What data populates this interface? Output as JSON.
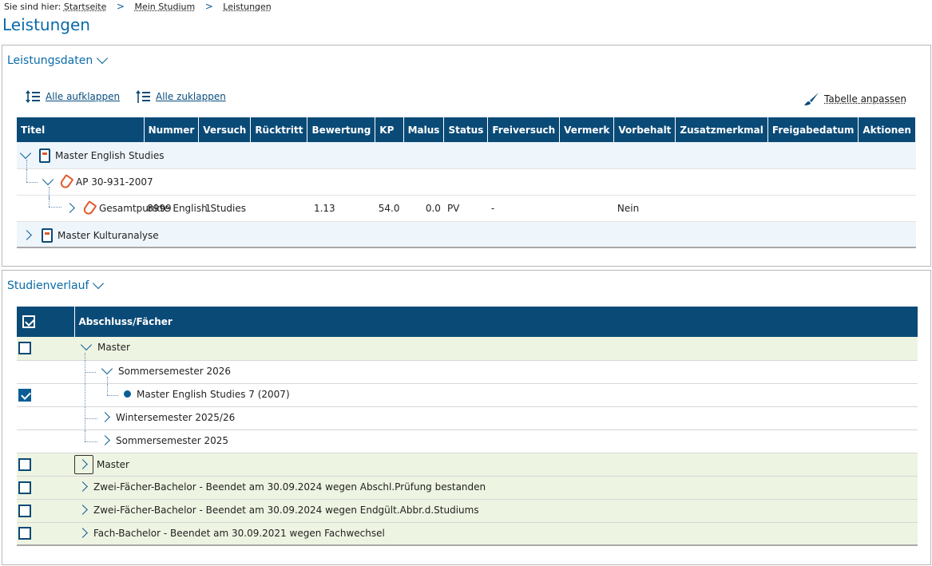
{
  "breadcrumb": {
    "prefix": "Sie sind hier:",
    "items": [
      "Startseite",
      "Mein Studium",
      "Leistungen"
    ]
  },
  "page_title": "Leistungen",
  "leistungsdaten": {
    "title": "Leistungsdaten",
    "expand_all": "Alle aufklappen",
    "collapse_all": "Alle zuklappen",
    "customize_table": "Tabelle anpassen",
    "columns": [
      "Titel",
      "Nummer",
      "Versuch",
      "Rücktritt",
      "Bewertung",
      "KP",
      "Malus",
      "Status",
      "Freiversuch",
      "Vermerk",
      "Vorbehalt",
      "Zusatzmerkmal",
      "Freigabedatum",
      "Aktionen"
    ],
    "rows": [
      {
        "title": "Master English Studies",
        "nummer": "",
        "versuch": "",
        "ruecktritt": "",
        "bewertung": "",
        "kp": "",
        "malus": "",
        "status": "",
        "freiversuch": "",
        "vermerk": "",
        "vorbehalt": ""
      },
      {
        "title": "AP 30-931-2007",
        "nummer": "",
        "versuch": "",
        "ruecktritt": "",
        "bewertung": "",
        "kp": "",
        "malus": "",
        "status": "",
        "freiversuch": "",
        "vermerk": "",
        "vorbehalt": ""
      },
      {
        "title": "Gesamtpunkte English Studies",
        "nummer": "8999",
        "versuch": "1",
        "ruecktritt": "",
        "bewertung": "1.13",
        "kp": "54.0",
        "malus": "0.0",
        "status": "PV",
        "freiversuch": "-",
        "vermerk": "",
        "vorbehalt": "Nein"
      },
      {
        "title": "Master Kulturanalyse",
        "nummer": "",
        "versuch": "",
        "ruecktritt": "",
        "bewertung": "",
        "kp": "",
        "malus": "",
        "status": "",
        "freiversuch": "",
        "vermerk": "",
        "vorbehalt": ""
      }
    ]
  },
  "studienverlauf": {
    "title": "Studienverlauf",
    "column": "Abschluss/Fächer",
    "rows": [
      {
        "label": "Master"
      },
      {
        "label": "Sommersemester 2026"
      },
      {
        "label": "Master English Studies 7 (2007)"
      },
      {
        "label": "Wintersemester 2025/26"
      },
      {
        "label": "Sommersemester 2025"
      },
      {
        "label": "Master"
      },
      {
        "label": "Zwei-Fächer-Bachelor - Beendet am 30.09.2024 wegen Abschl.Prüfung bestanden"
      },
      {
        "label": "Zwei-Fächer-Bachelor - Beendet am 30.09.2024 wegen Endgült.Abbr.d.Studiums"
      },
      {
        "label": "Fach-Bachelor - Beendet am 30.09.2021 wegen Fachwechsel"
      }
    ]
  }
}
